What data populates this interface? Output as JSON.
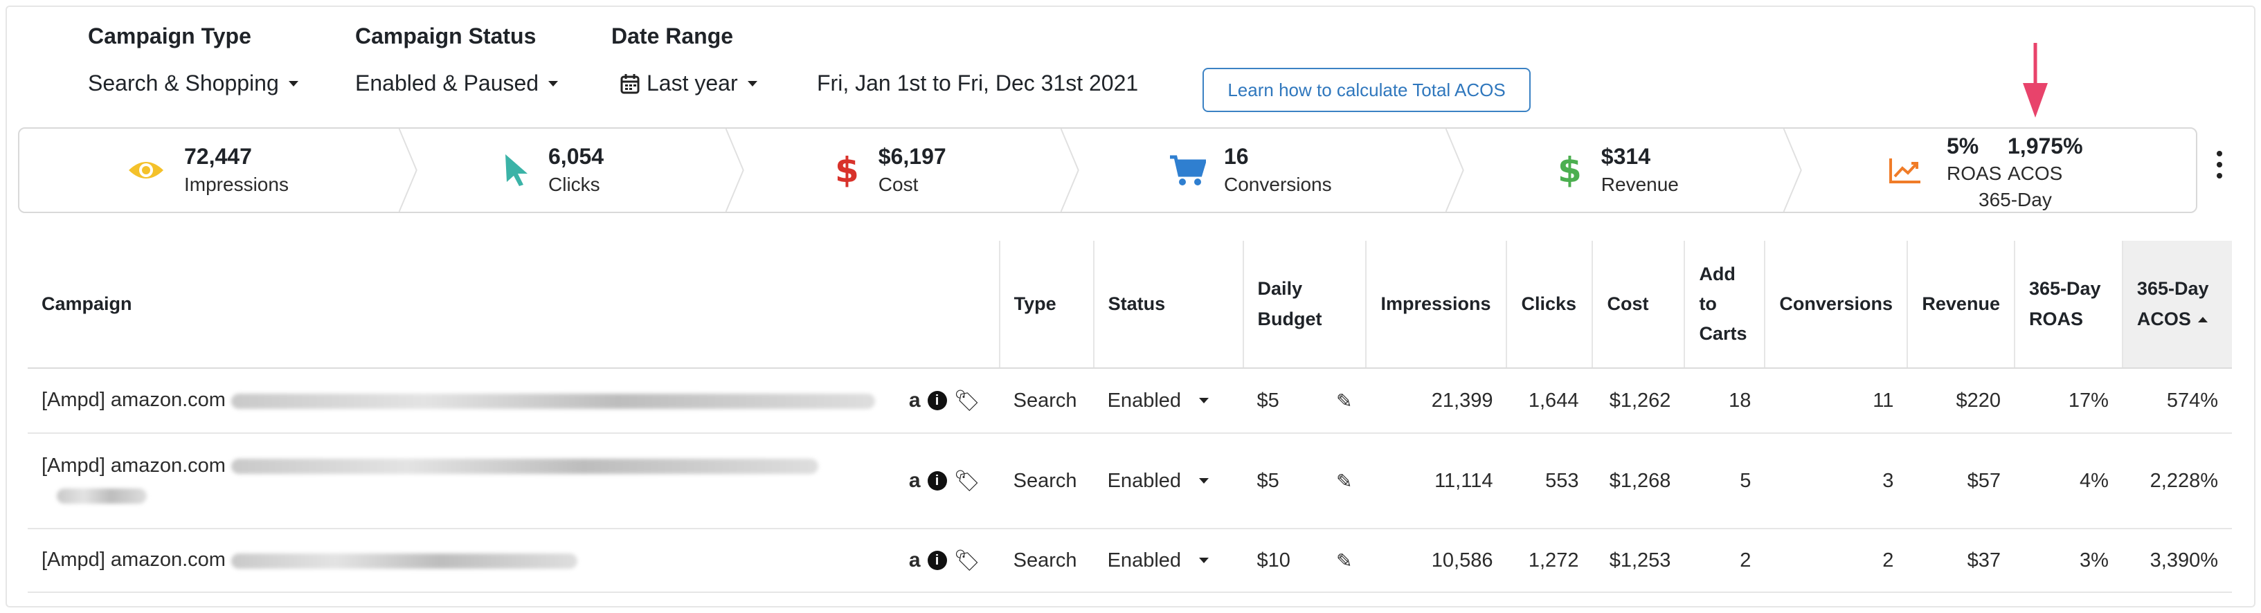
{
  "filters": {
    "campaign_type": {
      "label": "Campaign Type",
      "value": "Search & Shopping"
    },
    "campaign_status": {
      "label": "Campaign Status",
      "value": "Enabled & Paused"
    },
    "date_range": {
      "label": "Date Range",
      "value": "Last year",
      "range_text": "Fri, Jan 1st to Fri, Dec 31st 2021"
    },
    "learn_button": "Learn how to calculate Total ACOS"
  },
  "summary": {
    "impressions": {
      "value": "72,447",
      "label": "Impressions",
      "icon": "eye-icon",
      "color": "#f4c12a"
    },
    "clicks": {
      "value": "6,054",
      "label": "Clicks",
      "icon": "cursor-icon",
      "color": "#3bb3a7"
    },
    "cost": {
      "value": "$6,197",
      "label": "Cost",
      "icon": "dollar-icon",
      "color": "#d8322b"
    },
    "conversions": {
      "value": "16",
      "label": "Conversions",
      "icon": "cart-icon",
      "color": "#2f7fd0"
    },
    "revenue": {
      "value": "$314",
      "label": "Revenue",
      "icon": "dollar-icon",
      "color": "#4caf50"
    },
    "roas": {
      "value": "5%",
      "label": "ROAS"
    },
    "acos": {
      "value": "1,975%",
      "label": "ACOS"
    },
    "period": "365-Day",
    "trend_icon": "trend-up-icon",
    "trend_color": "#f07c28",
    "arrow_color": "#e8436b"
  },
  "table": {
    "headers": {
      "campaign": "Campaign",
      "type": "Type",
      "status": "Status",
      "daily_budget_1": "Daily",
      "daily_budget_2": "Budget",
      "impressions": "Impressions",
      "clicks": "Clicks",
      "cost": "Cost",
      "add_to_carts_1": "Add",
      "add_to_carts_2": "to",
      "add_to_carts_3": "Carts",
      "conversions": "Conversions",
      "revenue": "Revenue",
      "roas_1": "365-Day",
      "roas_2": "ROAS",
      "acos_1": "365-Day",
      "acos_2": "ACOS"
    },
    "rows": [
      {
        "campaign": "[Ampd] amazon.com",
        "type": "Search",
        "status": "Enabled",
        "budget": "$5",
        "impressions": "21,399",
        "clicks": "1,644",
        "cost": "$1,262",
        "add_to_carts": "18",
        "conversions": "11",
        "revenue": "$220",
        "roas": "17%",
        "acos": "574%"
      },
      {
        "campaign": "[Ampd] amazon.com",
        "type": "Search",
        "status": "Enabled",
        "budget": "$5",
        "impressions": "11,114",
        "clicks": "553",
        "cost": "$1,268",
        "add_to_carts": "5",
        "conversions": "3",
        "revenue": "$57",
        "roas": "4%",
        "acos": "2,228%"
      },
      {
        "campaign": "[Ampd] amazon.com",
        "type": "Search",
        "status": "Enabled",
        "budget": "$10",
        "impressions": "10,586",
        "clicks": "1,272",
        "cost": "$1,253",
        "add_to_carts": "2",
        "conversions": "2",
        "revenue": "$37",
        "roas": "3%",
        "acos": "3,390%"
      }
    ]
  }
}
